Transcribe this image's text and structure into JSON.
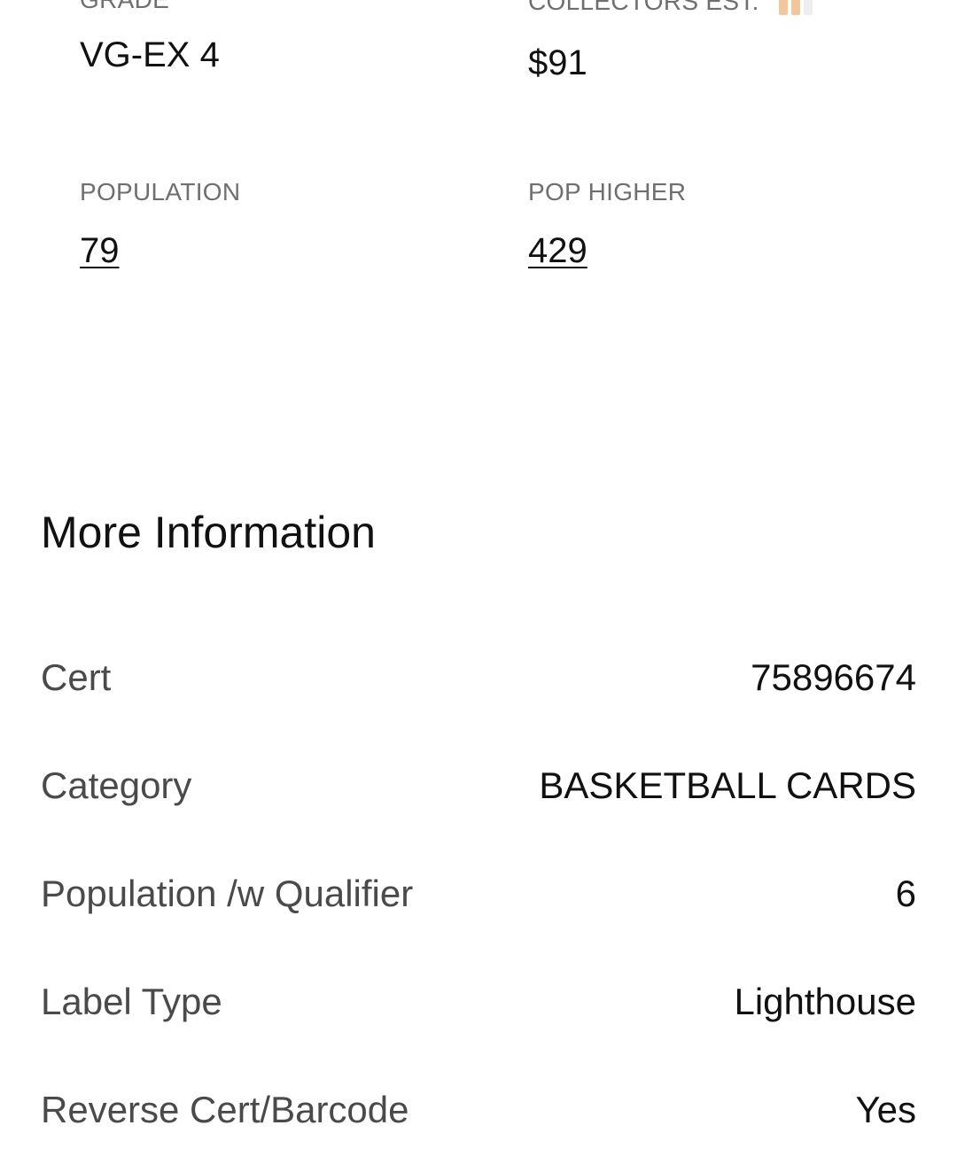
{
  "stats": {
    "grade": {
      "label": "GRADE",
      "value": "VG-EX 4"
    },
    "collectors_est": {
      "label": "COLLECTORS EST.",
      "value": "$91",
      "icon": "bar-chart-icon"
    },
    "population": {
      "label": "POPULATION",
      "value": "79"
    },
    "pop_higher": {
      "label": "POP HIGHER",
      "value": "429"
    }
  },
  "more_info": {
    "title": "More Information",
    "rows": [
      {
        "key": "Cert",
        "value": "75896674"
      },
      {
        "key": "Category",
        "value": "BASKETBALL CARDS"
      },
      {
        "key": "Population /w Qualifier",
        "value": "6"
      },
      {
        "key": "Label Type",
        "value": "Lighthouse"
      },
      {
        "key": "Reverse Cert/Barcode",
        "value": "Yes"
      }
    ]
  },
  "colors": {
    "icon_accent": "#f2c89a",
    "label_gray": "#6f6f6f"
  }
}
